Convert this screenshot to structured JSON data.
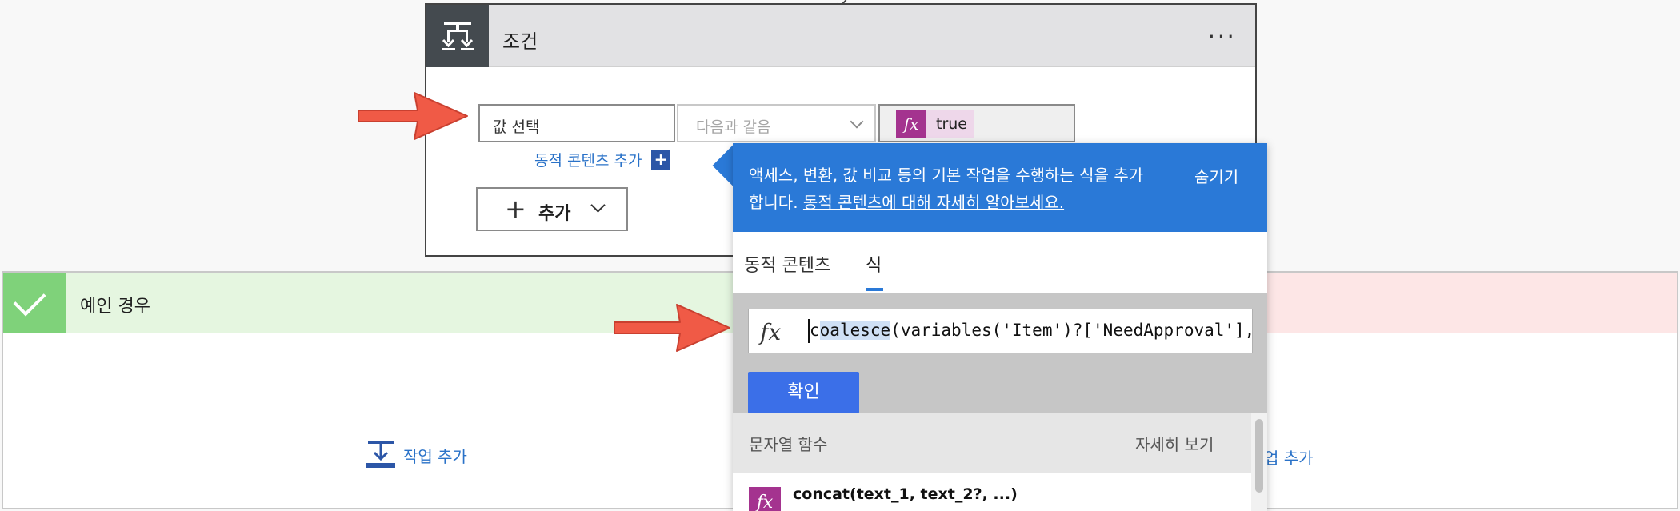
{
  "condition": {
    "title": "조건",
    "more_label": "···",
    "value_placeholder": "값 선택",
    "operator": "다음과 같음",
    "token_label": "true",
    "dynamic_content_link": "동적 콘텐츠 추가",
    "add_label": "추가"
  },
  "branches": {
    "yes_title": "예인 경우",
    "add_task_label": "작업 추가",
    "no_add_task_label": "업 추가"
  },
  "popup": {
    "banner_line1": "액세스, 변환, 값 비교 등의 기본 작업을 수행하는 식을 추가",
    "banner_line2_prefix": "합니다. ",
    "banner_link": "동적 콘텐츠에 대해 자세히 알아보세요.",
    "hide_label": "숨기기",
    "tabs": [
      "동적 콘텐츠",
      "식"
    ],
    "active_tab": "식",
    "expression_prefix": "c",
    "expression_highlight": "oalesce",
    "expression_rest": "(variables('Item')?['NeedApproval'],",
    "ok_label": "확인",
    "category_title": "문자열 함수",
    "category_more": "자세히 보기",
    "function_name": "concat(text_1, text_2?, ...)"
  },
  "colors": {
    "banner": "#2a79d7",
    "token_purple": "#a4338f",
    "ok_button": "#3b6fe8",
    "yes_accent": "#7fd27a",
    "arrow": "#f05a46"
  }
}
